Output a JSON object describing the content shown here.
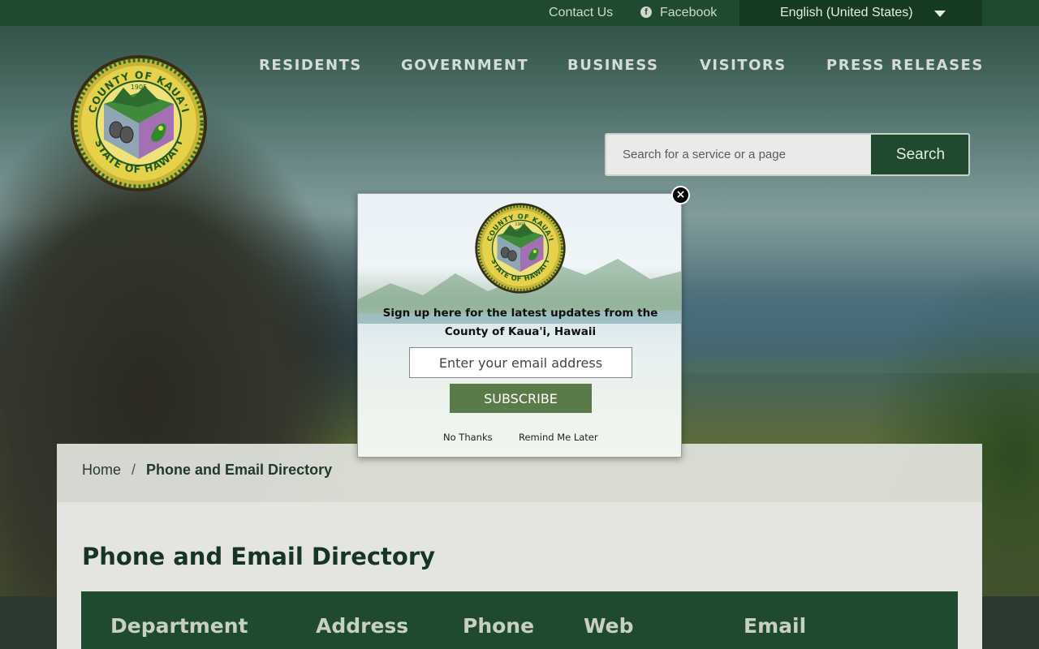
{
  "topbar": {
    "contact_label": "Contact Us",
    "facebook_label": "Facebook",
    "language_label": "English (United States)"
  },
  "seal": {
    "top_text": "COUNTY OF KAUA'I",
    "bottom_text": "STATE OF HAWAI'I",
    "year": "1905"
  },
  "nav": {
    "items": [
      "RESIDENTS",
      "GOVERNMENT",
      "BUSINESS",
      "VISITORS",
      "PRESS RELEASES"
    ]
  },
  "search": {
    "placeholder": "Search for a service or a page",
    "button_label": "Search"
  },
  "breadcrumb": {
    "home": "Home",
    "separator": "/",
    "current": "Phone and Email Directory"
  },
  "page": {
    "title": "Phone and Email Directory",
    "table_columns": [
      "Department",
      "Address",
      "Phone",
      "Web",
      "Email"
    ]
  },
  "modal": {
    "message": "Sign up here for the latest updates from the County of Kaua'i, Hawaii",
    "email_placeholder": "Enter your email address",
    "subscribe_label": "SUBSCRIBE",
    "no_thanks_label": "No Thanks",
    "remind_label": "Remind Me Later",
    "close_glyph": "×"
  },
  "colors": {
    "brand_green": "#1f4a2f",
    "subscribe_green": "#5b7a4a"
  }
}
